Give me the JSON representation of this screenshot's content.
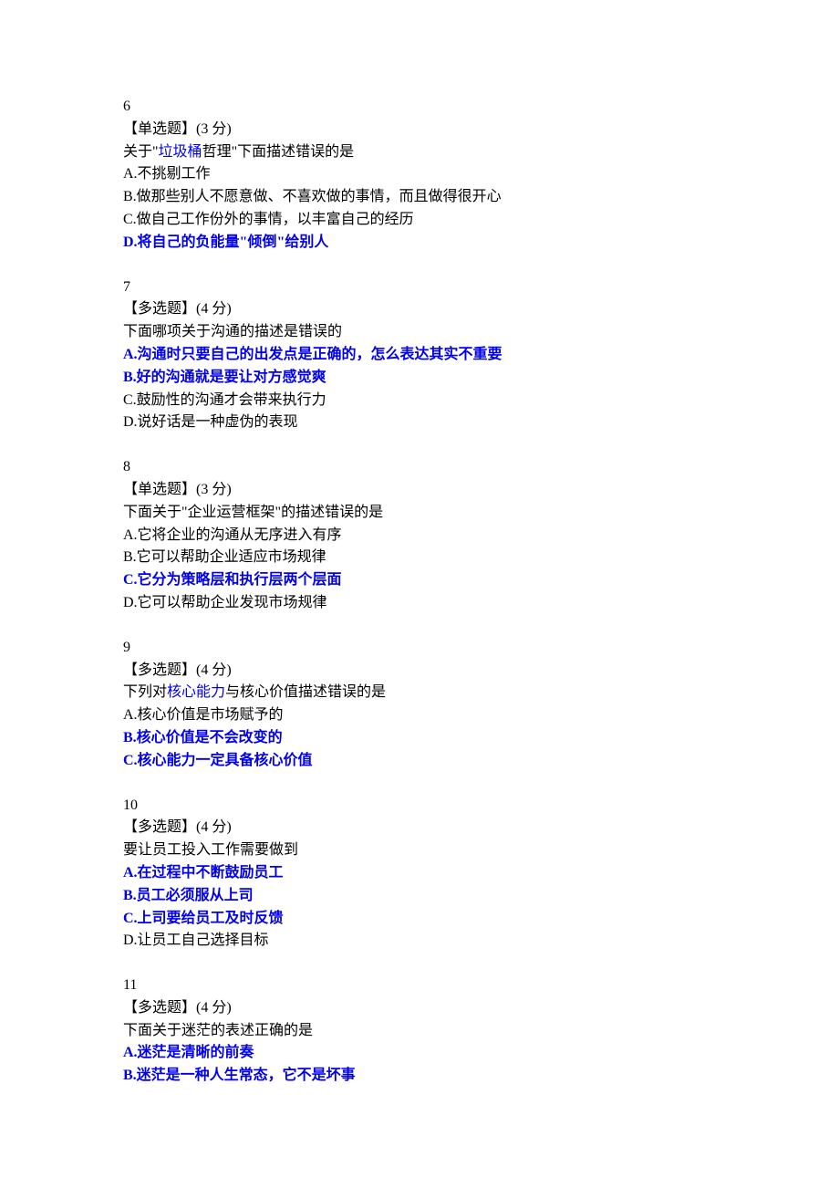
{
  "questions": [
    {
      "number": "6",
      "type": "【单选题】(3 分)",
      "stem_pre": "关于\"",
      "stem_link": "垃圾桶",
      "stem_post": "哲理\"下面描述错误的是",
      "options": [
        {
          "label": "A.不挑剔工作",
          "highlight": false
        },
        {
          "label": "B.做那些别人不愿意做、不喜欢做的事情，而且做得很开心",
          "highlight": false
        },
        {
          "label": "C.做自己工作份外的事情，以丰富自己的经历",
          "highlight": false
        },
        {
          "label": "D.将自己的负能量\"倾倒\"给别人",
          "highlight": true
        }
      ]
    },
    {
      "number": "7",
      "type": "【多选题】(4 分)",
      "stem": "下面哪项关于沟通的描述是错误的",
      "options": [
        {
          "label": "A.沟通时只要自己的出发点是正确的，怎么表达其实不重要",
          "highlight": true
        },
        {
          "label": "B.好的沟通就是要让对方感觉爽",
          "highlight": true
        },
        {
          "label": "C.鼓励性的沟通才会带来执行力",
          "highlight": false
        },
        {
          "label": "D.说好话是一种虚伪的表现",
          "highlight": false
        }
      ]
    },
    {
      "number": "8",
      "type": "【单选题】(3 分)",
      "stem": "下面关于\"企业运营框架\"的描述错误的是",
      "options": [
        {
          "label": "A.它将企业的沟通从无序进入有序",
          "highlight": false
        },
        {
          "label": "B.它可以帮助企业适应市场规律",
          "highlight": false
        },
        {
          "label": "C.它分为策略层和执行层两个层面",
          "highlight": true
        },
        {
          "label": "D.它可以帮助企业发现市场规律",
          "highlight": false
        }
      ]
    },
    {
      "number": "9",
      "type": "【多选题】(4 分)",
      "stem_pre": "下列对",
      "stem_link": "核心能力",
      "stem_post": "与核心价值描述错误的是",
      "options": [
        {
          "label": "A.核心价值是市场赋予的",
          "highlight": false
        },
        {
          "label": "B.核心价值是不会改变的",
          "highlight": true
        },
        {
          "label": "C.核心能力一定具备核心价值",
          "highlight": true
        }
      ]
    },
    {
      "number": "10",
      "type": "【多选题】(4 分)",
      "stem": "要让员工投入工作需要做到",
      "options": [
        {
          "label": "A.在过程中不断鼓励员工",
          "highlight": true
        },
        {
          "label": "B.员工必须服从上司",
          "highlight": true
        },
        {
          "label": "C.上司要给员工及时反馈",
          "highlight": true
        },
        {
          "label": "D.让员工自己选择目标",
          "highlight": false
        }
      ]
    },
    {
      "number": "11",
      "type": "【多选题】(4 分)",
      "stem": "下面关于迷茫的表述正确的是",
      "options": [
        {
          "label": "A.迷茫是清晰的前奏",
          "highlight": true
        },
        {
          "label": "B.迷茫是一种人生常态，它不是坏事",
          "highlight": true
        }
      ]
    }
  ]
}
